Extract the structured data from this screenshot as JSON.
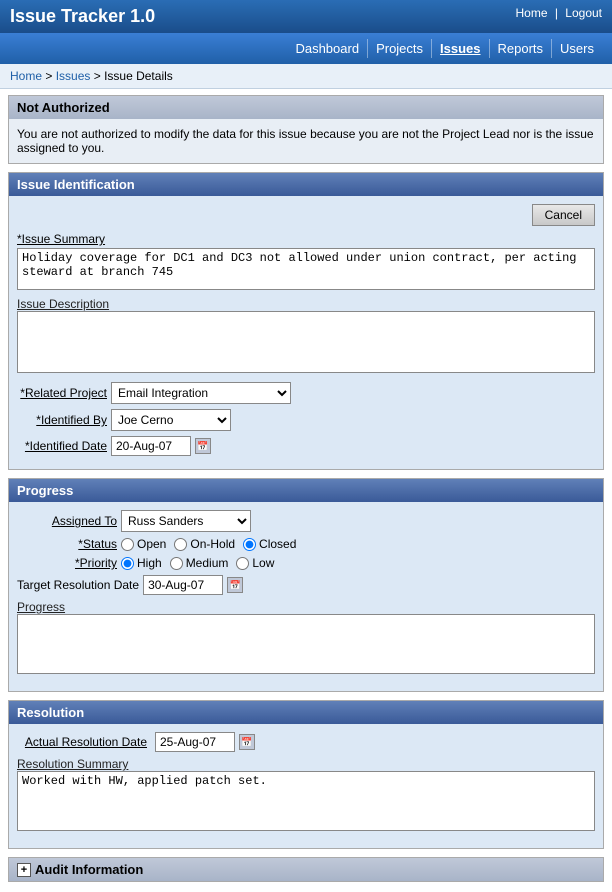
{
  "app": {
    "title": "Issue Tracker 1.0",
    "header_links": {
      "home": "Home",
      "logout": "Logout"
    }
  },
  "navbar": {
    "items": [
      {
        "label": "Dashboard",
        "active": false
      },
      {
        "label": "Projects",
        "active": false
      },
      {
        "label": "Issues",
        "active": true
      },
      {
        "label": "Reports",
        "active": false
      },
      {
        "label": "Users",
        "active": false
      }
    ]
  },
  "breadcrumb": {
    "home": "Home",
    "issues": "Issues",
    "current": "Issue Details"
  },
  "not_authorized": {
    "header": "Not Authorized",
    "message": "You are not authorized to modify the data for this issue because you are not the Project Lead nor is the issue assigned to you."
  },
  "issue_identification": {
    "section_title": "Issue Identification",
    "cancel_label": "Cancel",
    "summary_label": "*Issue Summary",
    "summary_value": "Holiday coverage for DC1 and DC3 not allowed under union contract, per acting steward at branch 745",
    "description_label": "Issue Description",
    "description_value": "",
    "related_project_label": "*Related Project",
    "related_project_value": "Email Integration",
    "related_project_options": [
      "Email Integration"
    ],
    "identified_by_label": "*Identified By",
    "identified_by_value": "Joe Cerno",
    "identified_by_options": [
      "Joe Cerno"
    ],
    "identified_date_label": "*Identified Date",
    "identified_date_value": "20-Aug-07"
  },
  "progress": {
    "section_title": "Progress",
    "assigned_to_label": "Assigned To",
    "assigned_to_value": "Russ Sanders",
    "assigned_to_options": [
      "Russ Sanders"
    ],
    "status_label": "*Status",
    "status_options": [
      "Open",
      "On-Hold",
      "Closed"
    ],
    "status_selected": "Closed",
    "priority_label": "*Priority",
    "priority_options": [
      "High",
      "Medium",
      "Low"
    ],
    "priority_selected": "High",
    "target_resolution_label": "Target Resolution Date",
    "target_resolution_value": "30-Aug-07",
    "progress_label": "Progress",
    "progress_value": ""
  },
  "resolution": {
    "section_title": "Resolution",
    "actual_resolution_label": "Actual Resolution Date",
    "actual_resolution_value": "25-Aug-07",
    "summary_label": "Resolution Summary",
    "summary_value": "Worked with HW, applied patch set."
  },
  "audit": {
    "header": "Audit Information",
    "expanded": false
  }
}
